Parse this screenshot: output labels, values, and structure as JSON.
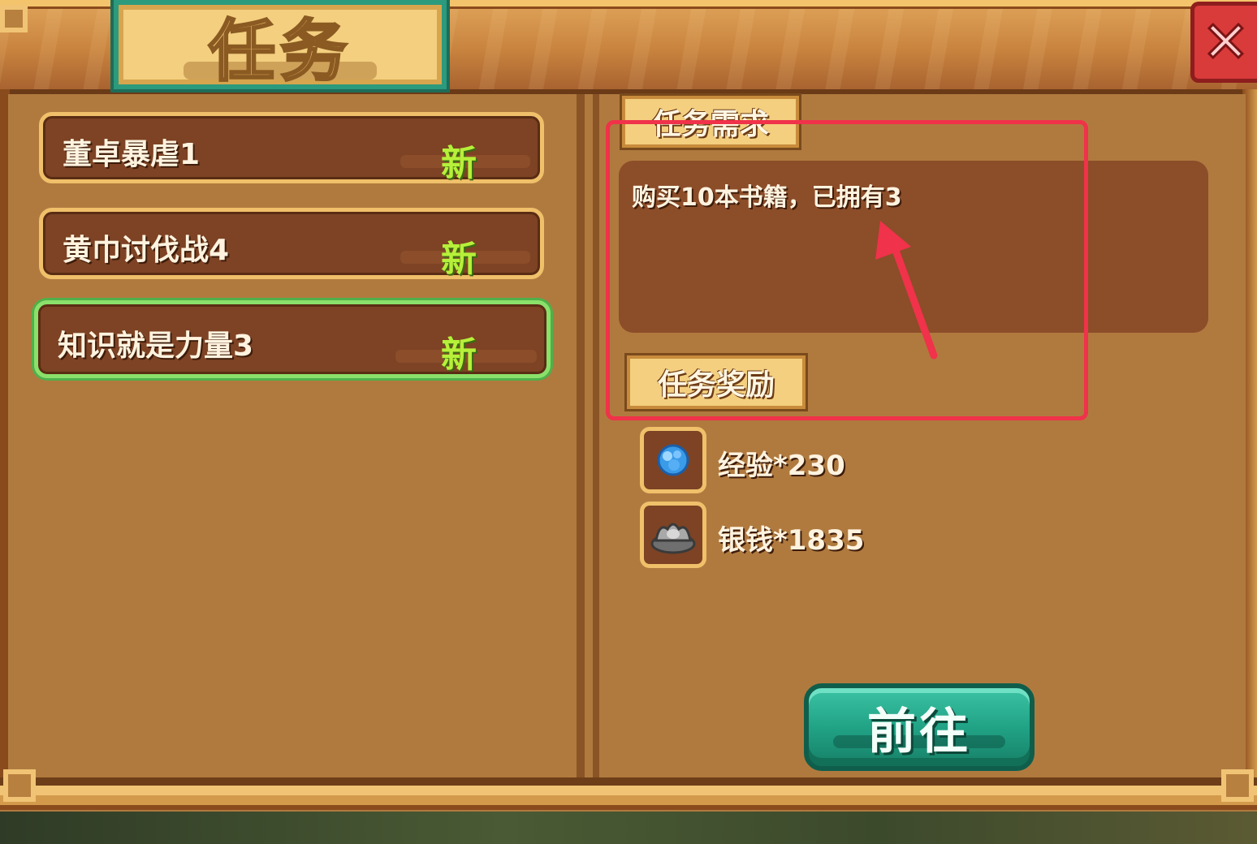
{
  "window": {
    "title": "任务",
    "close_icon": "close-icon"
  },
  "quests": [
    {
      "name": "董卓暴虐1",
      "badge": "新",
      "selected": false
    },
    {
      "name": "黄巾讨伐战4",
      "badge": "新",
      "selected": false
    },
    {
      "name": "知识就是力量3",
      "badge": "新",
      "selected": true
    }
  ],
  "requirement": {
    "header": "任务需求",
    "text": "购买10本书籍，已拥有3"
  },
  "reward": {
    "header": "任务奖励",
    "items": [
      {
        "icon": "experience-crystal-icon",
        "label": "经验*230"
      },
      {
        "icon": "silver-ingot-icon",
        "label": "银钱*1835"
      }
    ]
  },
  "actions": {
    "go_label": "前往"
  },
  "colors": {
    "panel": "#b07a3f",
    "item_bg": "#7d4324",
    "item_border": "#f0c06a",
    "selected_border": "#8be06a",
    "new_badge": "#b6f03a",
    "button": "#21a386",
    "highlight": "#f0324a",
    "close": "#d93a3a"
  }
}
